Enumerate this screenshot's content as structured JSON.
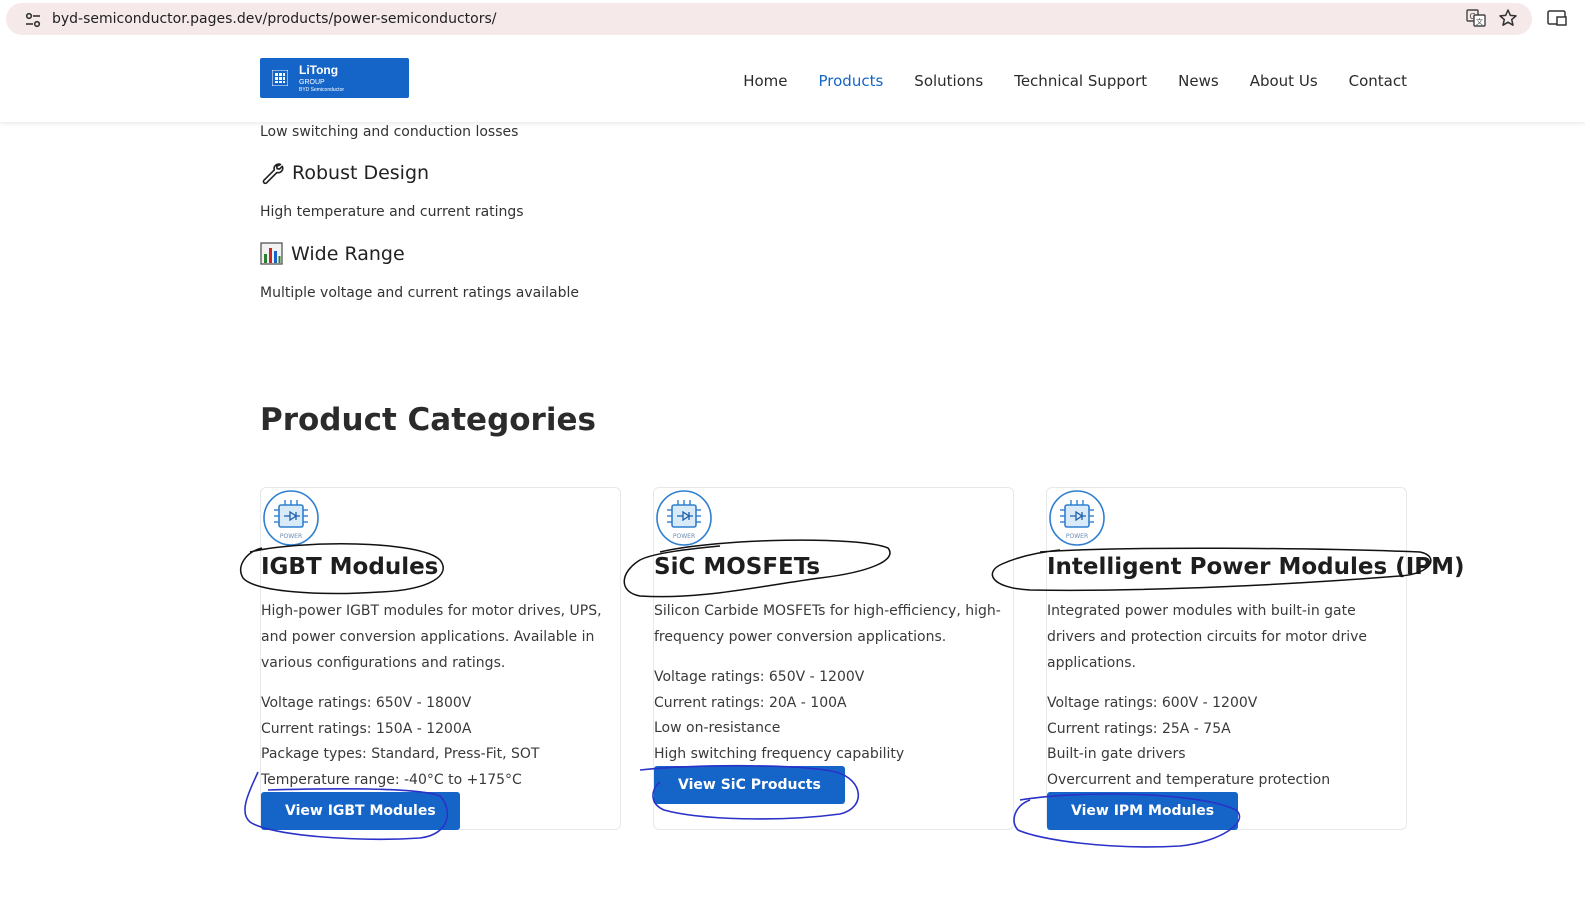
{
  "browser": {
    "url": "byd-semiconductor.pages.dev/products/power-semiconductors/"
  },
  "logo": {
    "title": "LiTong",
    "sub1": "GROUP",
    "sub2": "BYD Semiconductor"
  },
  "nav": {
    "items": [
      {
        "label": "Home",
        "active": false
      },
      {
        "label": "Products",
        "active": true
      },
      {
        "label": "Solutions",
        "active": false
      },
      {
        "label": "Technical Support",
        "active": false
      },
      {
        "label": "News",
        "active": false
      },
      {
        "label": "About Us",
        "active": false
      },
      {
        "label": "Contact",
        "active": false
      }
    ]
  },
  "features": {
    "partial_desc": "Low switching and conduction losses",
    "items": [
      {
        "icon": "wrench-icon",
        "title": "Robust Design",
        "desc": "High temperature and current ratings"
      },
      {
        "icon": "bar-chart-icon",
        "title": "Wide Range",
        "desc": "Multiple voltage and current ratings available"
      }
    ]
  },
  "section": {
    "title": "Product Categories"
  },
  "cards": [
    {
      "icon": "power-chip-icon",
      "icon_label": "POWER",
      "title": "IGBT Modules",
      "desc": "High-power IGBT modules for motor drives, UPS, and power conversion applications. Available in various configurations and ratings.",
      "specs": [
        "Voltage ratings: 650V - 1800V",
        "Current ratings: 150A - 1200A",
        "Package types: Standard, Press-Fit, SOT",
        "Temperature range: -40°C to +175°C"
      ],
      "button": "View IGBT Modules"
    },
    {
      "icon": "power-chip-icon",
      "icon_label": "POWER",
      "title": "SiC MOSFETs",
      "desc": "Silicon Carbide MOSFETs for high-efficiency, high-frequency power conversion applications.",
      "specs": [
        "Voltage ratings: 650V - 1200V",
        "Current ratings: 20A - 100A",
        "Low on-resistance",
        "High switching frequency capability"
      ],
      "button": "View SiC Products"
    },
    {
      "icon": "power-chip-icon",
      "icon_label": "POWER",
      "title": "Intelligent Power Modules (IPM)",
      "desc": "Integrated power modules with built-in gate drivers and protection circuits for motor drive applications.",
      "specs": [
        "Voltage ratings: 600V - 1200V",
        "Current ratings: 25A - 75A",
        "Built-in gate drivers",
        "Overcurrent and temperature protection"
      ],
      "button": "View IPM Modules"
    }
  ],
  "colors": {
    "brand": "#1565c8",
    "annotation_black": "#111111",
    "annotation_blue": "#2a32c8"
  }
}
